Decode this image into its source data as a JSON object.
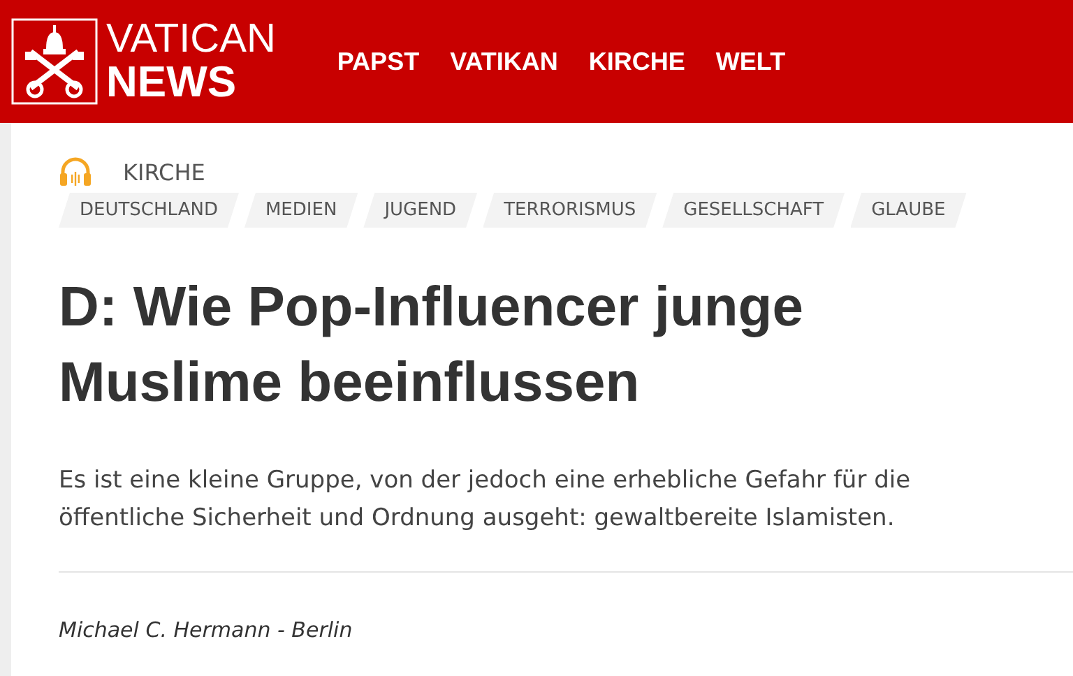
{
  "header": {
    "logo_top": "VATICAN",
    "logo_bottom": "NEWS",
    "nav": [
      {
        "label": "PAPST"
      },
      {
        "label": "VATIKAN"
      },
      {
        "label": "KIRCHE"
      },
      {
        "label": "WELT"
      }
    ]
  },
  "article": {
    "section": "KIRCHE",
    "tags": [
      "DEUTSCHLAND",
      "MEDIEN",
      "JUGEND",
      "TERRORISMUS",
      "GESELLSCHAFT",
      "GLAUBE"
    ],
    "title": "D: Wie Pop-Influencer junge Muslime beeinflussen",
    "summary": "Es ist eine kleine Gruppe, von der jedoch eine erhebliche Gefahr für die öffentliche Sicherheit und Ordnung ausgeht: gewaltbereite Islamisten.",
    "author": "Michael C. Hermann - Berlin"
  }
}
